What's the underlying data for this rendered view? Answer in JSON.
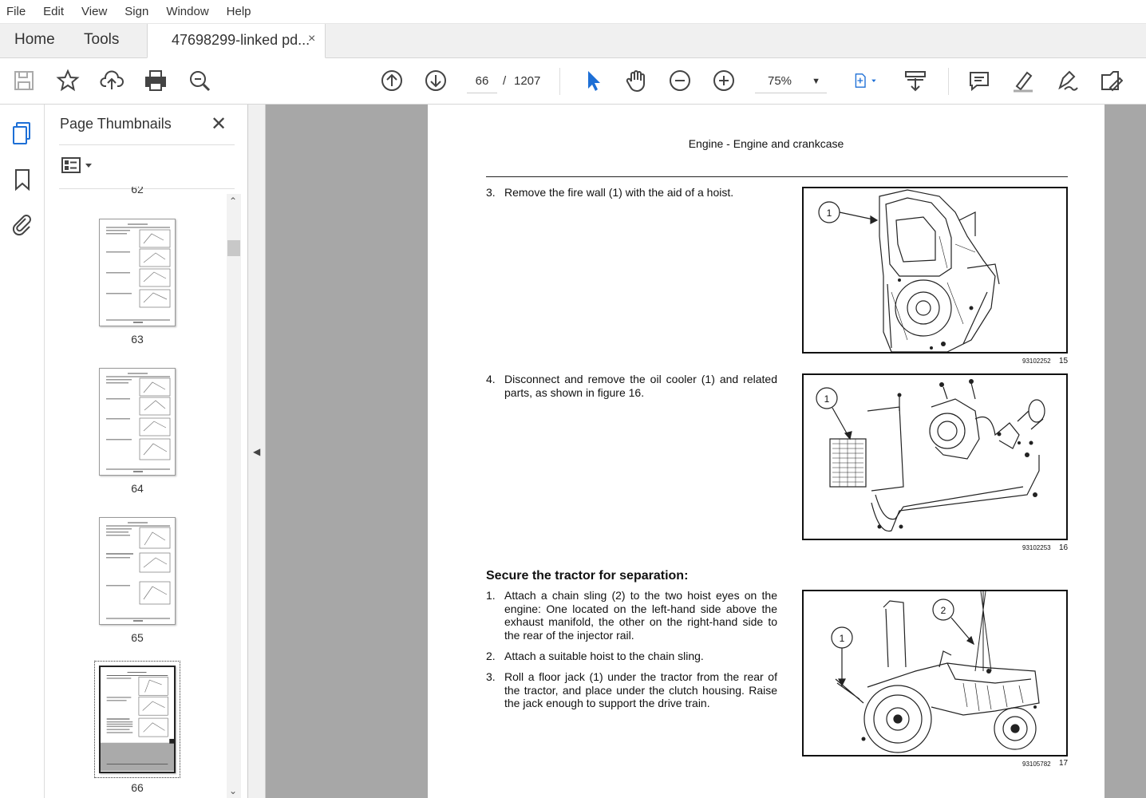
{
  "menu": [
    "File",
    "Edit",
    "View",
    "Sign",
    "Window",
    "Help"
  ],
  "tabs": {
    "home": "Home",
    "tools": "Tools",
    "doc_title": "47698299-linked pd...",
    "close_glyph": "×"
  },
  "toolbar": {
    "page_current": "66",
    "page_sep": "/",
    "page_total": "1207",
    "zoom": "75%"
  },
  "panel": {
    "title": "Page Thumbnails",
    "close_glyph": "✕",
    "partial_label": "62",
    "thumbs": [
      {
        "label": "63"
      },
      {
        "label": "64"
      },
      {
        "label": "65"
      },
      {
        "label": "66"
      }
    ]
  },
  "page": {
    "header": "Engine - Engine and crankcase",
    "steps_a": [
      {
        "n": "3.",
        "text": "Remove the fire wall (1) with the aid of a hoist."
      },
      {
        "n": "4.",
        "text": "Disconnect and remove the oil cooler (1) and related parts, as shown in figure 16."
      }
    ],
    "section_title": "Secure the tractor for separation:",
    "steps_b": [
      {
        "n": "1.",
        "text": "Attach a chain sling (2) to the two hoist eyes on the engine: One located on the left-hand side above the exhaust manifold, the other on the right-hand side to the rear of the injector rail."
      },
      {
        "n": "2.",
        "text": "Attach a suitable hoist to the chain sling."
      },
      {
        "n": "3.",
        "text": "Roll a floor jack (1) under the tractor from the rear of the tractor, and place under the clutch housing. Raise the jack enough to support the drive train."
      }
    ],
    "figures": [
      {
        "code": "93102252",
        "num": "15",
        "callouts": [
          "1"
        ]
      },
      {
        "code": "93102253",
        "num": "16",
        "callouts": [
          "1"
        ]
      },
      {
        "code": "93105782",
        "num": "17",
        "callouts": [
          "1",
          "2"
        ]
      }
    ]
  }
}
